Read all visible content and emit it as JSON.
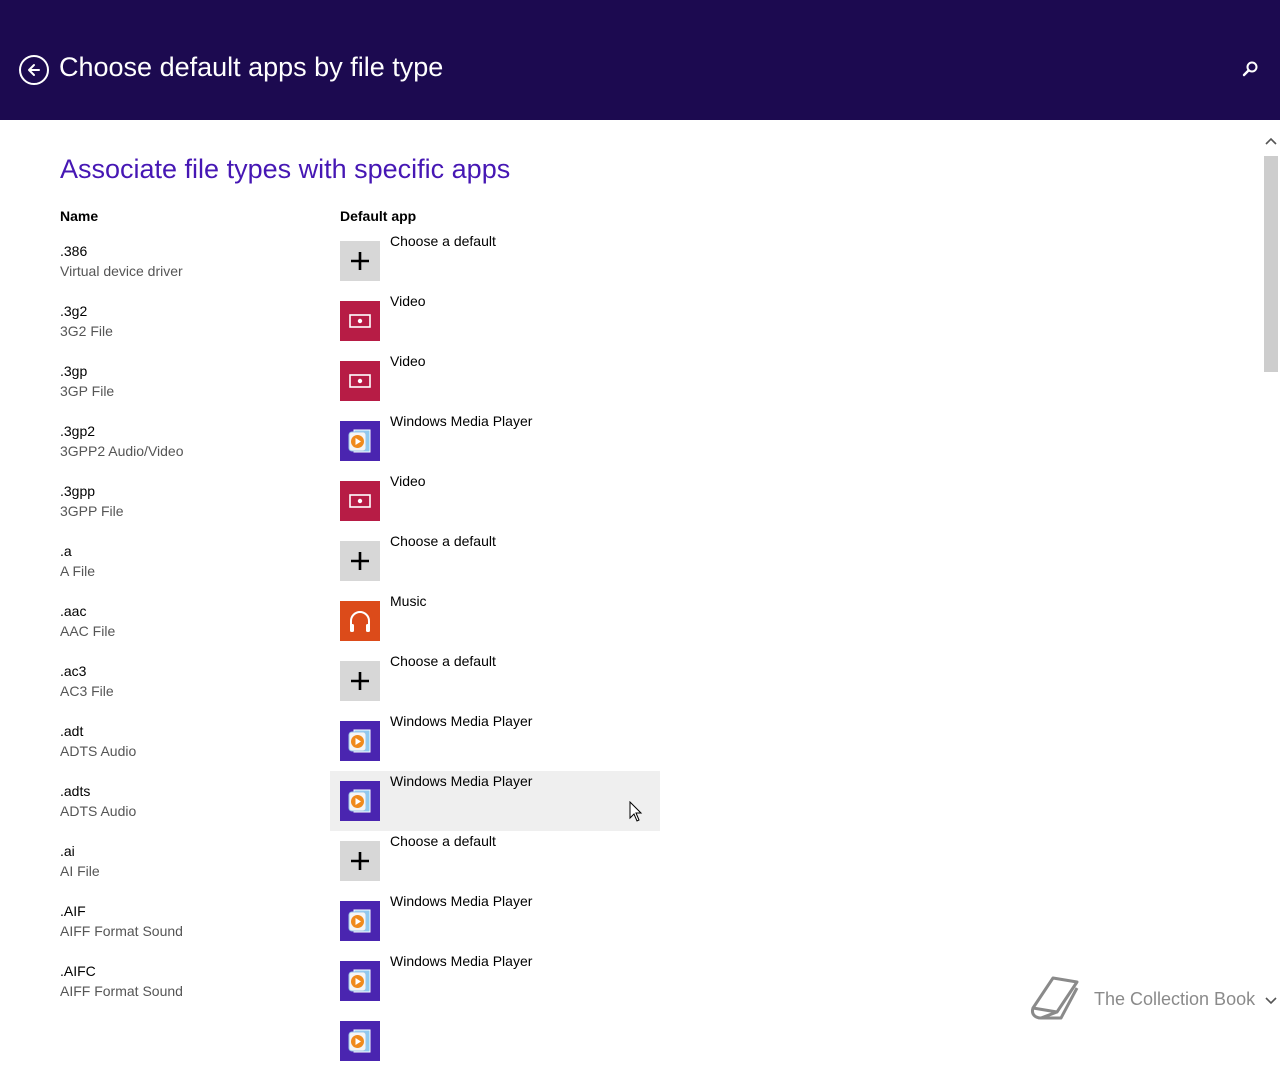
{
  "header": {
    "title": "Choose default apps by file type",
    "back_icon": "back-arrow-circle-icon",
    "search_icon": "search-icon",
    "background": "#1c0a50"
  },
  "section": {
    "title": "Associate file types with specific apps",
    "accent": "#4617b4"
  },
  "columns": {
    "name": "Name",
    "default_app": "Default app"
  },
  "rows": [
    {
      "ext": ".386",
      "desc": "Virtual device driver",
      "app": "Choose a default",
      "icon": "plus"
    },
    {
      "ext": ".3g2",
      "desc": "3G2 File",
      "app": "Video",
      "icon": "video"
    },
    {
      "ext": ".3gp",
      "desc": "3GP File",
      "app": "Video",
      "icon": "video"
    },
    {
      "ext": ".3gp2",
      "desc": "3GPP2 Audio/Video",
      "app": "Windows Media Player",
      "icon": "wmp"
    },
    {
      "ext": ".3gpp",
      "desc": "3GPP File",
      "app": "Video",
      "icon": "video"
    },
    {
      "ext": ".a",
      "desc": "A File",
      "app": "Choose a default",
      "icon": "plus"
    },
    {
      "ext": ".aac",
      "desc": "AAC File",
      "app": "Music",
      "icon": "music"
    },
    {
      "ext": ".ac3",
      "desc": "AC3 File",
      "app": "Choose a default",
      "icon": "plus"
    },
    {
      "ext": ".adt",
      "desc": "ADTS Audio",
      "app": "Windows Media Player",
      "icon": "wmp"
    },
    {
      "ext": ".adts",
      "desc": "ADTS Audio",
      "app": "Windows Media Player",
      "icon": "wmp",
      "hover": true
    },
    {
      "ext": ".ai",
      "desc": "AI File",
      "app": "Choose a default",
      "icon": "plus"
    },
    {
      "ext": ".AIF",
      "desc": "AIFF Format Sound",
      "app": "Windows Media Player",
      "icon": "wmp"
    },
    {
      "ext": ".AIFC",
      "desc": "AIFF Format Sound",
      "app": "Windows Media Player",
      "icon": "wmp"
    },
    {
      "ext": "",
      "desc": "",
      "app": "",
      "icon": "wmp"
    }
  ],
  "icon_colors": {
    "plus": "#d7d7d7",
    "video": "#b71c45",
    "music": "#dc4b1a",
    "wmp": "#4a25b0"
  },
  "watermark": {
    "text": "The Collection Book",
    "icon": "book-icon"
  }
}
